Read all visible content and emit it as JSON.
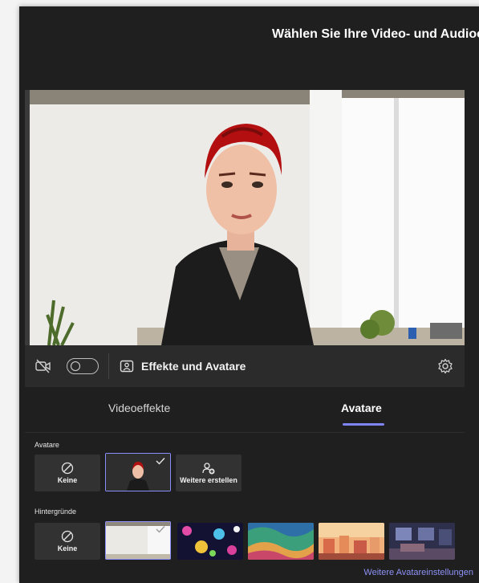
{
  "dialog": {
    "title": "Wählen Sie Ihre Video- und Audiooptionen"
  },
  "toolbar": {
    "camera_icon": "camera-off-icon",
    "camera_toggle_on": false,
    "effects_label": "Effekte und Avatare",
    "effects_icon": "image-person-icon",
    "settings_icon": "gear-icon"
  },
  "tabs": [
    {
      "label": "Videoeffekte",
      "selected": false
    },
    {
      "label": "Avatare",
      "selected": true
    }
  ],
  "avatars": {
    "section_label": "Avatare",
    "items": [
      {
        "label": "Keine",
        "icon": "none-icon",
        "selected": false
      },
      {
        "label": "",
        "icon": "avatar-thumbnail",
        "selected": true
      },
      {
        "label": "Weitere erstellen",
        "icon": "person-add-icon",
        "selected": false
      }
    ]
  },
  "backgrounds": {
    "section_label": "Hintergründe",
    "items": [
      {
        "label": "Keine",
        "icon": "none-icon",
        "selected": false
      },
      {
        "label": "",
        "thumb": "white-office",
        "selected": true
      },
      {
        "label": "",
        "thumb": "colorful-bokeh",
        "selected": false
      },
      {
        "label": "",
        "thumb": "abstract-waves",
        "selected": false
      },
      {
        "label": "",
        "thumb": "sunset-town",
        "selected": false
      },
      {
        "label": "",
        "thumb": "dark-lounge",
        "selected": false
      }
    ]
  },
  "footer": {
    "link_label": "Weitere Avatareinstellungen"
  },
  "colors": {
    "panel": "#1f1f1f",
    "toolbar": "#2b2b2b",
    "accent": "#7f85f5",
    "tile": "#323232"
  }
}
